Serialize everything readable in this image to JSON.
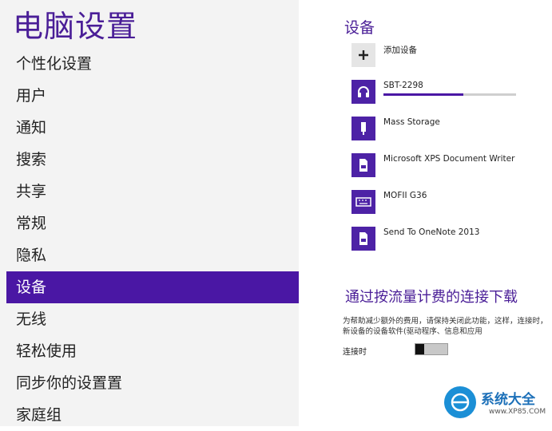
{
  "page_title": "电脑设置",
  "nav": {
    "items": [
      {
        "label": "个性化设置",
        "selected": false
      },
      {
        "label": "用户",
        "selected": false
      },
      {
        "label": "通知",
        "selected": false
      },
      {
        "label": "搜索",
        "selected": false
      },
      {
        "label": "共享",
        "selected": false
      },
      {
        "label": "常规",
        "selected": false
      },
      {
        "label": "隐私",
        "selected": false
      },
      {
        "label": "设备",
        "selected": true
      },
      {
        "label": "无线",
        "selected": false
      },
      {
        "label": "轻松使用",
        "selected": false
      },
      {
        "label": "同步你的设置置",
        "selected": false
      },
      {
        "label": "家庭组",
        "selected": false
      }
    ]
  },
  "devices": {
    "section_title": "设备",
    "add_label": "添加设备",
    "items": [
      {
        "name": "SBT-2298",
        "icon": "headset-icon",
        "progress": 0.6
      },
      {
        "name": "Mass Storage",
        "icon": "usb-drive-icon"
      },
      {
        "name": "Microsoft XPS Document Writer",
        "icon": "printer-icon"
      },
      {
        "name": "MOFII G36",
        "icon": "keyboard-icon"
      },
      {
        "name": "Send To OneNote 2013",
        "icon": "printer-icon"
      }
    ]
  },
  "metered": {
    "title": "通过按流量计费的连接下载",
    "description": "为帮助减少额外的费用，请保持关闭此功能，这样，连接时，新设备的设备软件(驱动程序、信息和应用",
    "toggle_label": "连接时",
    "toggle_on": false
  },
  "watermark": {
    "text": "系统大全",
    "url": "www.XP85.COM"
  },
  "colors": {
    "accent": "#4a17a4",
    "title": "#4a1e97",
    "left_bg": "#f3f3f3"
  }
}
